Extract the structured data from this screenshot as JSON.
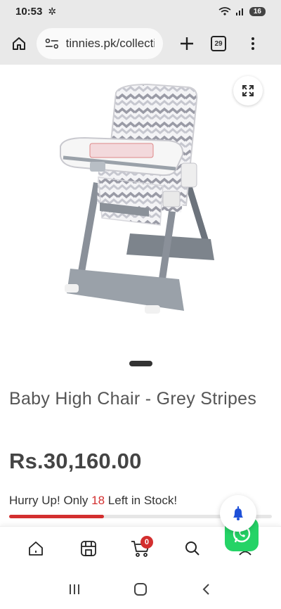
{
  "status_bar": {
    "time": "10:53",
    "battery": "16"
  },
  "browser": {
    "url": "tinnies.pk/collecti",
    "tab_count": "29"
  },
  "product": {
    "title": "Baby High Chair - Grey Stripes",
    "price": "Rs.30,160.00",
    "stock_prefix": "Hurry Up! Only ",
    "stock_count": "18",
    "stock_suffix": " Left in Stock!",
    "stock_level_fraction": 0.36
  },
  "store_nav": {
    "cart_count": "0",
    "items": [
      "home-icon",
      "store-icon",
      "cart-icon",
      "search-icon",
      "account-icon"
    ]
  },
  "colors": {
    "accent": "#d32f2f",
    "whatsapp": "#25d366",
    "browser_chrome": "#e9e9e9"
  }
}
